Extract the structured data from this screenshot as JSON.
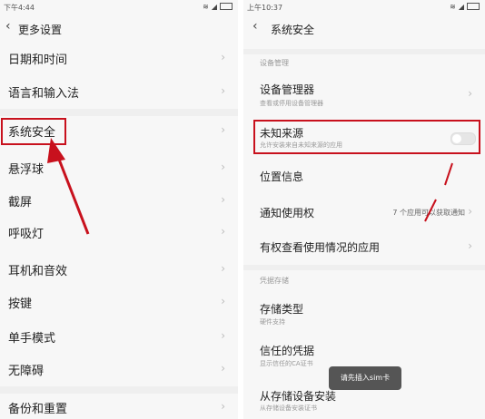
{
  "left": {
    "status": {
      "time": "下午4:44"
    },
    "header": {
      "title": "更多设置"
    },
    "items": [
      {
        "label": "日期和时间"
      },
      {
        "label": "语言和输入法"
      },
      {
        "label": "系统安全"
      },
      {
        "label": "悬浮球"
      },
      {
        "label": "截屏"
      },
      {
        "label": "呼吸灯"
      },
      {
        "label": "耳机和音效"
      },
      {
        "label": "按键"
      },
      {
        "label": "单手模式"
      },
      {
        "label": "无障碍"
      },
      {
        "label": "备份和重置"
      }
    ]
  },
  "right": {
    "status": {
      "time": "上午10:37"
    },
    "header": {
      "title": "系统安全"
    },
    "section1": "设备管理",
    "items": [
      {
        "label": "设备管理器",
        "sub": "查看或停用设备管理器"
      },
      {
        "label": "未知来源",
        "sub": "允许安装来自未知来源的应用",
        "toggle": false
      },
      {
        "label": "位置信息"
      },
      {
        "label": "通知使用权",
        "value": "7 个应用可以获取通知"
      },
      {
        "label": "有权查看使用情况的应用"
      }
    ],
    "section2": "凭据存储",
    "items2": [
      {
        "label": "存储类型",
        "sub": "硬件支持"
      },
      {
        "label": "信任的凭据",
        "sub": "显示信任的CA证书"
      },
      {
        "label": "从存储设备安装",
        "sub": "从存储设备安装证书"
      }
    ],
    "toast": "请先插入sim卡"
  },
  "colors": {
    "highlight": "#c8111d",
    "background": "#f7f7f7"
  }
}
